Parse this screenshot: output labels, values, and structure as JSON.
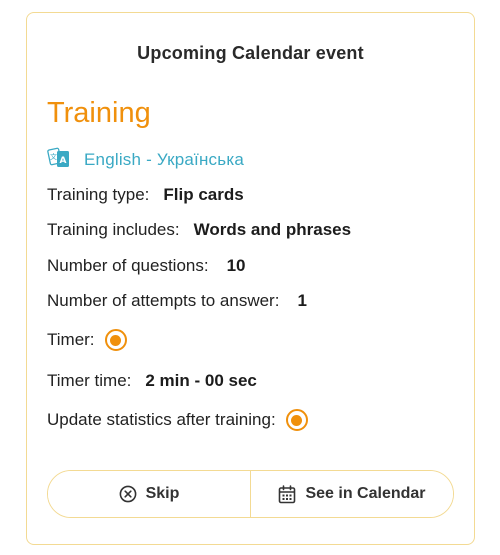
{
  "card": {
    "header": "Upcoming Calendar event",
    "title": "Training",
    "language": {
      "icon": "translate-cards-icon",
      "label": "English - Українська"
    },
    "details": {
      "training_type_label": "Training type:",
      "training_type_value": "Flip cards",
      "includes_label": "Training includes:",
      "includes_value": "Words and phrases",
      "questions_label": "Number of questions:",
      "questions_value": "10",
      "attempts_label": "Number of attempts to answer:",
      "attempts_value": "1",
      "timer_label": "Timer:",
      "timer_enabled": true,
      "timer_time_label": "Timer time:",
      "timer_time_value": "2 min - 00 sec",
      "update_stats_label": "Update statistics after training:",
      "update_stats_enabled": true
    },
    "buttons": {
      "skip_label": "Skip",
      "skip_icon": "close-circle-icon",
      "calendar_label": "See in Calendar",
      "calendar_icon": "calendar-icon"
    }
  },
  "colors": {
    "accent": "#f0900c",
    "link": "#3aa9c4",
    "border": "#f3da93"
  }
}
